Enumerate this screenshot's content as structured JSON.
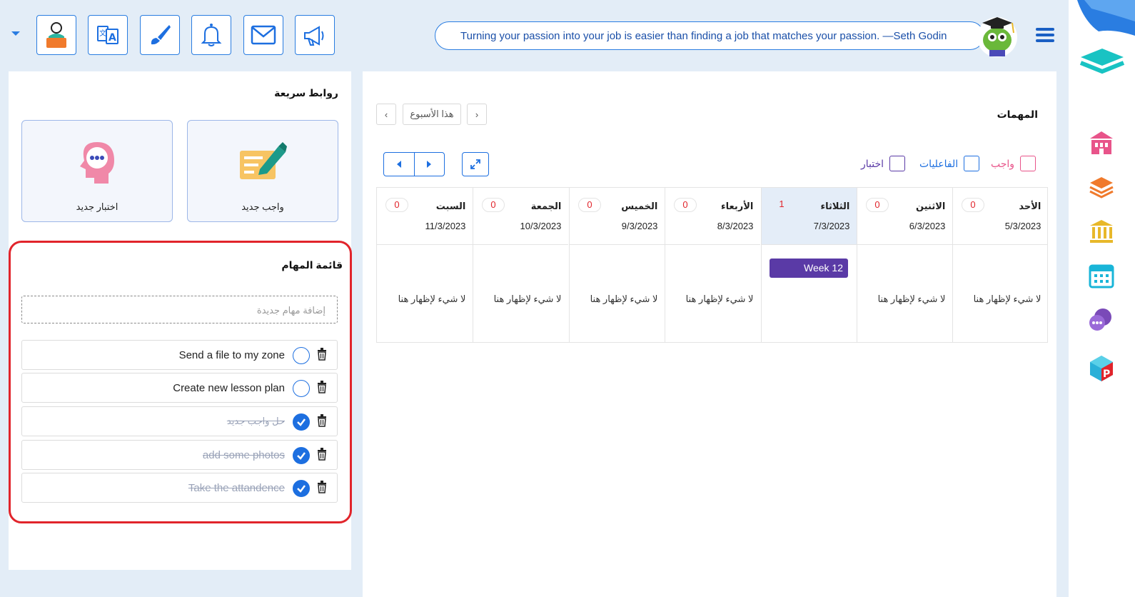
{
  "header": {
    "quote": "Turning your passion into your job is easier than finding a job that matches your passion. —Seth Godin",
    "toolbar": [
      "profile-icon",
      "translate-icon",
      "brush-icon",
      "bell-icon",
      "mail-icon",
      "megaphone-icon"
    ]
  },
  "quick_links": {
    "title": "روابط سريعة",
    "new_homework": "واجب جديد",
    "new_quiz": "اختبار جديد"
  },
  "tasks": {
    "title": "قائمة المهام",
    "add_placeholder": "إضافة مهام جديدة",
    "items": [
      {
        "text": "Send a file to my zone",
        "done": false
      },
      {
        "text": "Create new lesson plan",
        "done": false
      },
      {
        "text": "حل واجب جديد",
        "done": true
      },
      {
        "text": "add some photos",
        "done": true
      },
      {
        "text": "Take the attandence",
        "done": true
      }
    ]
  },
  "calendar": {
    "title": "المهمات",
    "this_week": "هذا الأسبوع",
    "filters": {
      "homework": "واجب",
      "activities": "الفاعليات",
      "quiz": "اختبار"
    },
    "empty_text": "لا شيء لإظهار هنا",
    "week_tag": "Week 12",
    "days": [
      {
        "name": "الأحد",
        "date": "5/3/2023",
        "count": "0"
      },
      {
        "name": "الاثنين",
        "date": "6/3/2023",
        "count": "0"
      },
      {
        "name": "الثلاثاء",
        "date": "7/3/2023",
        "count": "1"
      },
      {
        "name": "الأربعاء",
        "date": "8/3/2023",
        "count": "0"
      },
      {
        "name": "الخميس",
        "date": "9/3/2023",
        "count": "0"
      },
      {
        "name": "الجمعة",
        "date": "10/3/2023",
        "count": "0"
      },
      {
        "name": "السبت",
        "date": "11/3/2023",
        "count": "0"
      }
    ]
  },
  "colors": {
    "accent": "#1d6fe0",
    "alert": "#e1242b",
    "week_tag": "#5a3aa6",
    "homework": "#e8548a",
    "activities": "#1d6fe0",
    "quiz": "#5a3aa6"
  }
}
